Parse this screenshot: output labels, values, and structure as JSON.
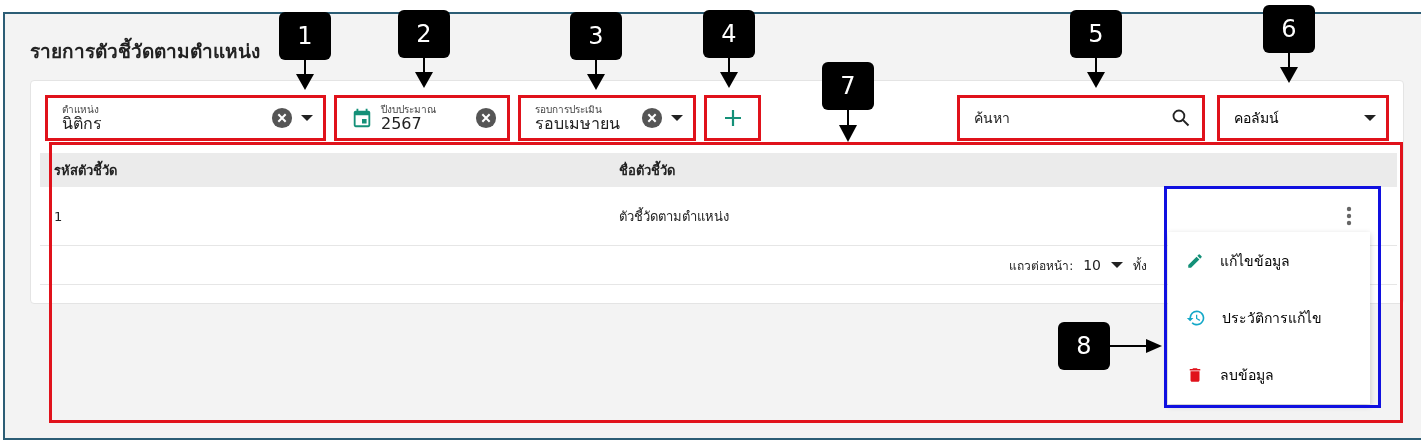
{
  "title": "รายการตัวชี้วัดตามตำแหน่ง",
  "filters": [
    {
      "kind": "select",
      "label": "ตำแหน่ง",
      "value": "นิติกร"
    },
    {
      "kind": "date",
      "label": "ปีงบประมาณ",
      "value": "2567"
    },
    {
      "kind": "select",
      "label": "รอบการประเมิน",
      "value": "รอบเมษายน"
    }
  ],
  "search": {
    "placeholder": "ค้นหา"
  },
  "columns_button": {
    "label": "คอลัมน์"
  },
  "table": {
    "columns": [
      "รหัสตัวชี้วัด",
      "ชื่อตัวชี้วัด"
    ],
    "rows": [
      [
        "1",
        "ตัวชี้วัดตามตำแหน่ง"
      ]
    ]
  },
  "pagination": {
    "rows_per_page_label": "แถวต่อหน้า:",
    "rows_per_page": "10",
    "range": "ทั้ง"
  },
  "row_menu": [
    {
      "kind": "edit",
      "label": "แก้ไขข้อมูล"
    },
    {
      "kind": "history",
      "label": "ประวัติการแก้ไข"
    },
    {
      "kind": "delete",
      "label": "ลบข้อมูล"
    }
  ],
  "callouts": [
    {
      "number": "1"
    },
    {
      "number": "2"
    },
    {
      "number": "3"
    },
    {
      "number": "4"
    },
    {
      "number": "5"
    },
    {
      "number": "6"
    },
    {
      "number": "7"
    },
    {
      "number": "8"
    }
  ]
}
